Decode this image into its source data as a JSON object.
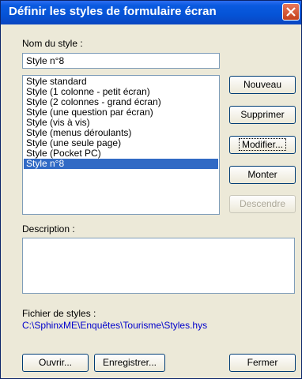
{
  "window": {
    "title": "Définir les styles de formulaire écran"
  },
  "style_name": {
    "label": "Nom du style :",
    "value": "Style n°8"
  },
  "styles_list": {
    "items": [
      "Style standard",
      "Style (1 colonne - petit écran)",
      "Style (2 colonnes - grand écran)",
      "Style (une question par écran)",
      "Style (vis à vis)",
      "Style (menus déroulants)",
      "Style (une seule page)",
      "Style (Pocket PC)",
      "Style n°8"
    ],
    "selected": "Style n°8"
  },
  "buttons": {
    "nouveau": "Nouveau",
    "supprimer": "Supprimer",
    "modifier": "Modifier...",
    "monter": "Monter",
    "descendre": "Descendre",
    "ouvrir": "Ouvrir...",
    "enregistrer": "Enregistrer...",
    "fermer": "Fermer"
  },
  "description": {
    "label": "Description :",
    "value": ""
  },
  "styles_file": {
    "label": "Fichier de styles :",
    "path": "C:\\SphinxME\\Enquêtes\\Tourisme\\Styles.hys"
  },
  "colors": {
    "titlebar": "#0553d6",
    "selection": "#316ac5",
    "path_link": "#0000cc"
  }
}
